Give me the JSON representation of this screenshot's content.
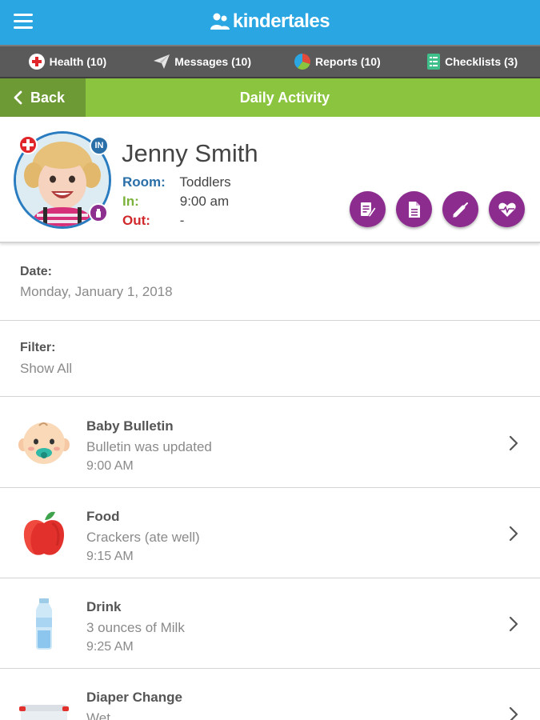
{
  "app": {
    "brand": "kindertales"
  },
  "nav": {
    "health": "Health (10)",
    "messages": "Messages (10)",
    "reports": "Reports (10)",
    "checklists": "Checklists (3)"
  },
  "header": {
    "back": "Back",
    "title": "Daily Activity"
  },
  "child": {
    "name": "Jenny Smith",
    "room_label": "Room:",
    "room": "Toddlers",
    "in_label": "In:",
    "in_time": "9:00 am",
    "out_label": "Out:",
    "out_time": "-",
    "in_badge": "IN"
  },
  "date": {
    "label": "Date:",
    "value": "Monday, January 1, 2018"
  },
  "filter": {
    "label": "Filter:",
    "value": "Show All"
  },
  "activities": [
    {
      "title": "Baby Bulletin",
      "detail": "Bulletin was updated",
      "time": "9:00 AM",
      "icon": "baby-face-icon"
    },
    {
      "title": "Food",
      "detail": "Crackers (ate well)",
      "time": "9:15 AM",
      "icon": "apple-icon"
    },
    {
      "title": "Drink",
      "detail": "3 ounces of Milk",
      "time": "9:25 AM",
      "icon": "water-bottle-icon"
    },
    {
      "title": "Diaper Change",
      "detail": "Wet",
      "time": "",
      "icon": "diaper-icon"
    }
  ],
  "colors": {
    "topbar": "#2aa6e2",
    "navbar": "#5a5a5a",
    "headerbar": "#8bc53f",
    "back_button": "#6e9a36",
    "action_purple": "#8b2c8e"
  }
}
